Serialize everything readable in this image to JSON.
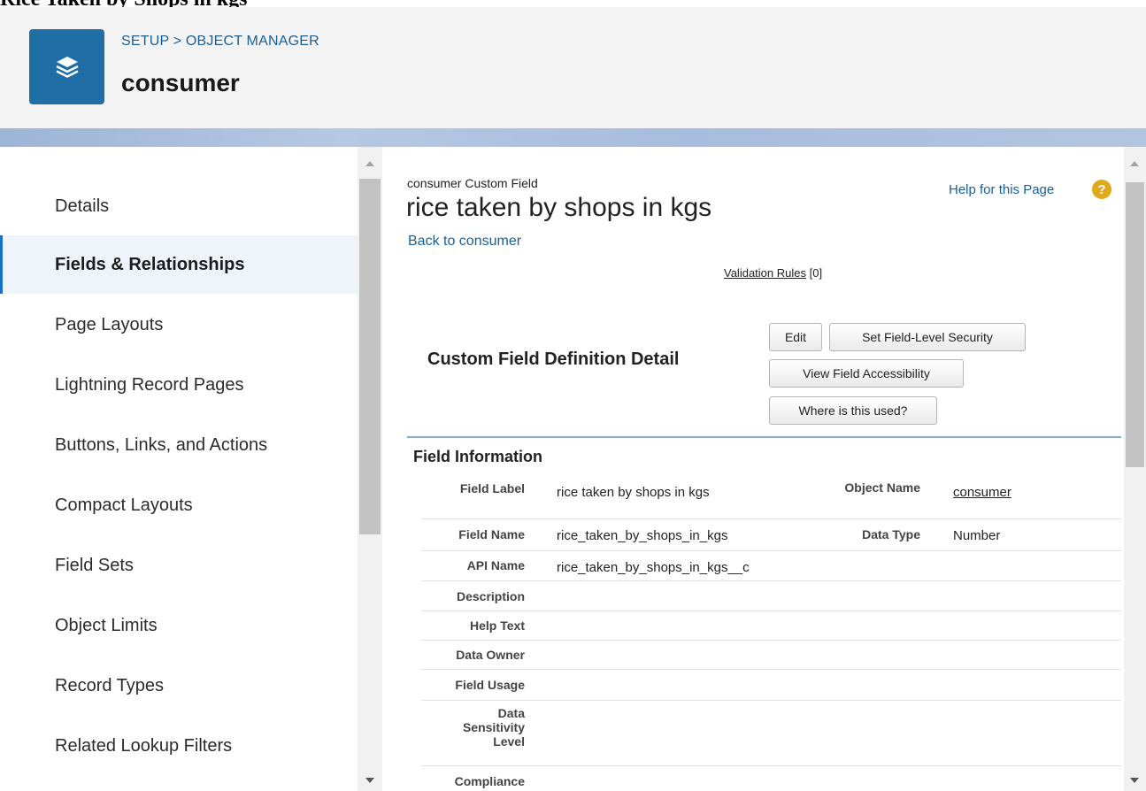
{
  "document_title": "Rice Taken by Shops in kgs",
  "header": {
    "breadcrumb": "SETUP > OBJECT MANAGER",
    "object_name": "consumer"
  },
  "sidebar": {
    "items": [
      {
        "label": "Details"
      },
      {
        "label": "Fields & Relationships",
        "active": true
      },
      {
        "label": "Page Layouts"
      },
      {
        "label": "Lightning Record Pages"
      },
      {
        "label": "Buttons, Links, and Actions"
      },
      {
        "label": "Compact Layouts"
      },
      {
        "label": "Field Sets"
      },
      {
        "label": "Object Limits"
      },
      {
        "label": "Record Types"
      },
      {
        "label": "Related Lookup Filters"
      }
    ]
  },
  "main": {
    "object_type": "consumer Custom Field",
    "field_title": "rice taken by shops in kgs",
    "back_link": "Back to consumer",
    "help_link": "Help for this Page",
    "help_icon": "?",
    "validation_rules_link": "Validation Rules",
    "validation_rules_count": "[0]",
    "section_title": "Custom Field Definition Detail",
    "buttons": {
      "edit": "Edit",
      "set_fls": "Set Field-Level Security",
      "view_accessibility": "View Field Accessibility",
      "where_used": "Where is this used?"
    },
    "field_info": {
      "title": "Field Information",
      "field_label_label": "Field Label",
      "field_label_value": "rice taken by shops in kgs",
      "object_name_label": "Object Name",
      "object_name_value": "consumer",
      "field_name_label": "Field Name",
      "field_name_value": "rice_taken_by_shops_in_kgs",
      "data_type_label": "Data Type",
      "data_type_value": "Number",
      "api_name_label": "API Name",
      "api_name_value": "rice_taken_by_shops_in_kgs__c",
      "description_label": "Description",
      "help_text_label": "Help Text",
      "data_owner_label": "Data Owner",
      "field_usage_label": "Field Usage",
      "data_sensitivity_label": "Data Sensitivity Level",
      "compliance_label": "Compliance"
    }
  },
  "colors": {
    "app_icon": "#1f6fa6",
    "link": "#1b5f95",
    "active_nav_bg": "#eef4fa",
    "help_icon": "#e0a81b"
  }
}
